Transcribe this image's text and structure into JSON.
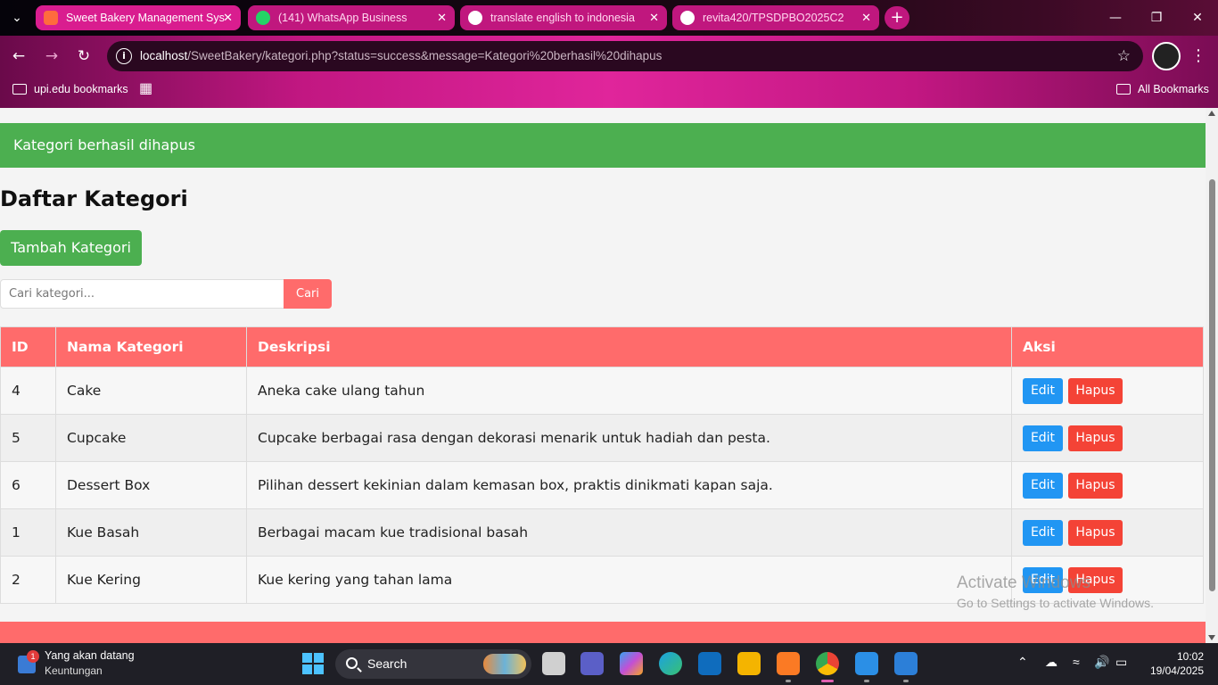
{
  "browser": {
    "tabs": [
      {
        "title": "Sweet Bakery Management Sys",
        "active": true
      },
      {
        "title": "(141) WhatsApp Business",
        "active": false
      },
      {
        "title": "translate english to indonesia",
        "active": false
      },
      {
        "title": "revita420/TPSDPBO2025C2",
        "active": false
      }
    ],
    "url_host": "localhost",
    "url_path": "/SweetBakery/kategori.php?status=success&message=Kategori%20berhasil%20dihapus",
    "bookmarks": {
      "folder": "upi.edu bookmarks",
      "all": "All Bookmarks"
    }
  },
  "alert": {
    "message": "Kategori berhasil dihapus"
  },
  "page": {
    "title": "Daftar Kategori",
    "add_button": "Tambah Kategori",
    "search": {
      "placeholder": "Cari kategori...",
      "button": "Cari"
    }
  },
  "table": {
    "headers": {
      "id": "ID",
      "name": "Nama Kategori",
      "desc": "Deskripsi",
      "action": "Aksi"
    },
    "edit_label": "Edit",
    "delete_label": "Hapus",
    "rows": [
      {
        "id": "4",
        "name": "Cake",
        "desc": "Aneka cake ulang tahun"
      },
      {
        "id": "5",
        "name": "Cupcake",
        "desc": "Cupcake berbagai rasa dengan dekorasi menarik untuk hadiah dan pesta."
      },
      {
        "id": "6",
        "name": "Dessert Box",
        "desc": "Pilihan dessert kekinian dalam kemasan box, praktis dinikmati kapan saja."
      },
      {
        "id": "1",
        "name": "Kue Basah",
        "desc": "Berbagai macam kue tradisional basah"
      },
      {
        "id": "2",
        "name": "Kue Kering",
        "desc": "Kue kering yang tahan lama"
      }
    ]
  },
  "watermark": {
    "line1": "Activate Windows",
    "line2": "Go to Settings to activate Windows."
  },
  "taskbar": {
    "news_title": "Yang akan datang",
    "news_sub": "Keuntungan",
    "news_badge": "1",
    "search_label": "Search",
    "time": "10:02",
    "date": "19/04/2025"
  },
  "colors": {
    "accent": "#ff6b6b",
    "success": "#4caf50",
    "edit": "#2196f3",
    "delete": "#f44336"
  }
}
